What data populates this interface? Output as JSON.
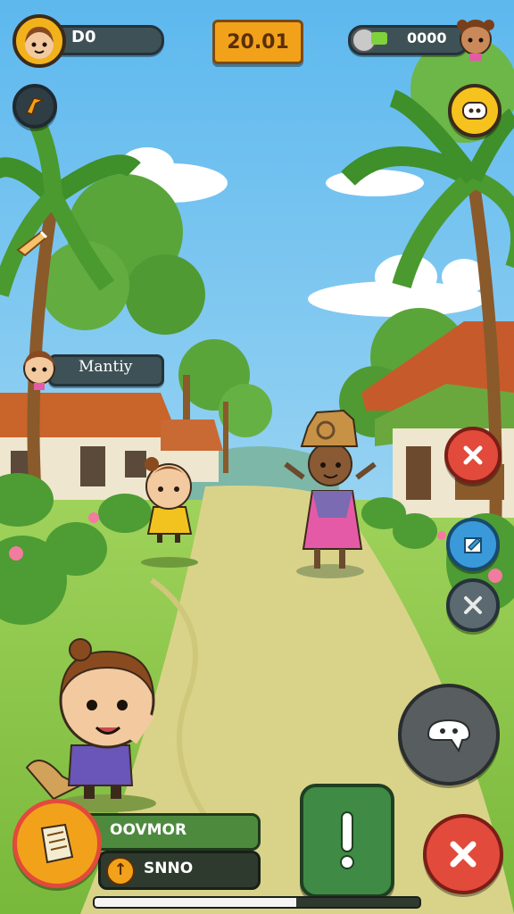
{
  "hud": {
    "player_counter": "D0",
    "coins": "20.01",
    "currency_value": "0000"
  },
  "npc_bubble": {
    "name": "Mantiy"
  },
  "bottom_panel": {
    "title": "OOVMOR",
    "sub_label": "SNNO"
  },
  "progress": {
    "fraction": 0.62
  },
  "colors": {
    "sky_top": "#6ec2ef",
    "grass": "#8cc63f",
    "path": "#d9d38a",
    "coin_panel": "#f2a21a",
    "close_red": "#e24a3b",
    "action_green": "#3f8a45"
  },
  "icons": {
    "top_left_avatar": "player-avatar-icon",
    "top_right_avatar": "friend-avatar-icon",
    "chat": "chat-icon",
    "boomerang": "boomerang-icon",
    "horn": "horn-icon",
    "close": "close-icon",
    "edit": "edit-icon",
    "tools": "tools-icon",
    "ghost": "ghost-icon",
    "exclaim": "exclamation-icon",
    "map": "map-icon",
    "arrow": "up-arrow-icon"
  }
}
